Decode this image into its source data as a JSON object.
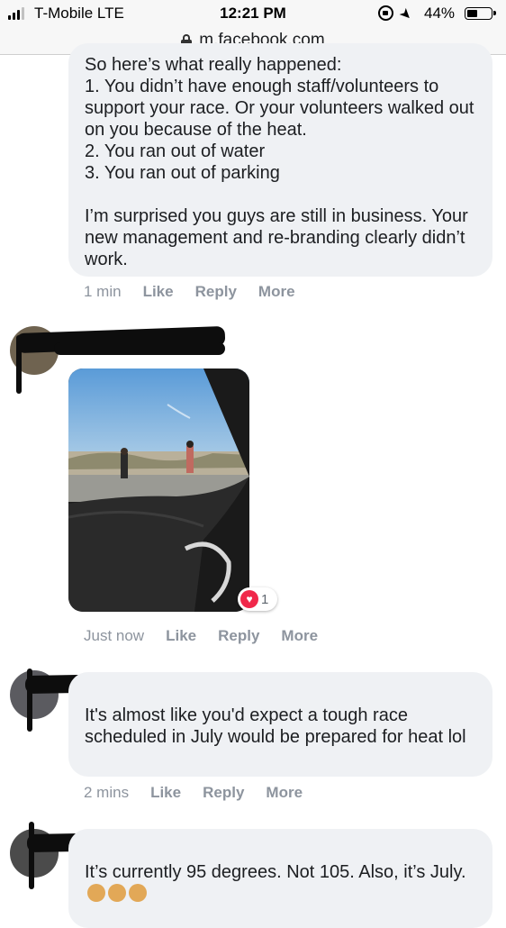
{
  "status_bar": {
    "carrier": "T-Mobile  LTE",
    "time": "12:21 PM",
    "battery_percent": "44%",
    "battery_level": 0.44,
    "signal_bars_active": 3
  },
  "url_bar": {
    "url": "m.facebook.com"
  },
  "comments": [
    {
      "text": "So here’s what really happened:\n1. You didn’t have enough staff/volunteers to support your race. Or your volunteers walked out on you because of the heat.\n2. You ran out of water\n3. You ran out of parking\n\nI’m surprised you guys are still in business. Your new management and re-branding clearly didn’t work.",
      "time": "1 min",
      "actions": [
        "Like",
        "Reply",
        "More"
      ]
    },
    {
      "reaction_count": "1",
      "time": "Just now",
      "actions": [
        "Like",
        "Reply",
        "More"
      ]
    },
    {
      "text": "It's almost like you'd expect a tough race scheduled in July would be prepared for heat lol",
      "time": "2 mins",
      "actions": [
        "Like",
        "Reply",
        "More"
      ]
    },
    {
      "text": "It’s currently 95 degrees. Not 105. Also, it’s July."
    }
  ],
  "icons": [
    "signal-icon",
    "rotation-lock-icon",
    "location-arrow-icon",
    "battery-icon",
    "padlock-icon",
    "heart-reaction-icon",
    "woman-shrugging-emoji"
  ],
  "colors": {
    "bubble": "#eff1f4",
    "muted_text": "#8d949e",
    "heart": "#f0284a",
    "redaction": "#0d0d0d"
  }
}
